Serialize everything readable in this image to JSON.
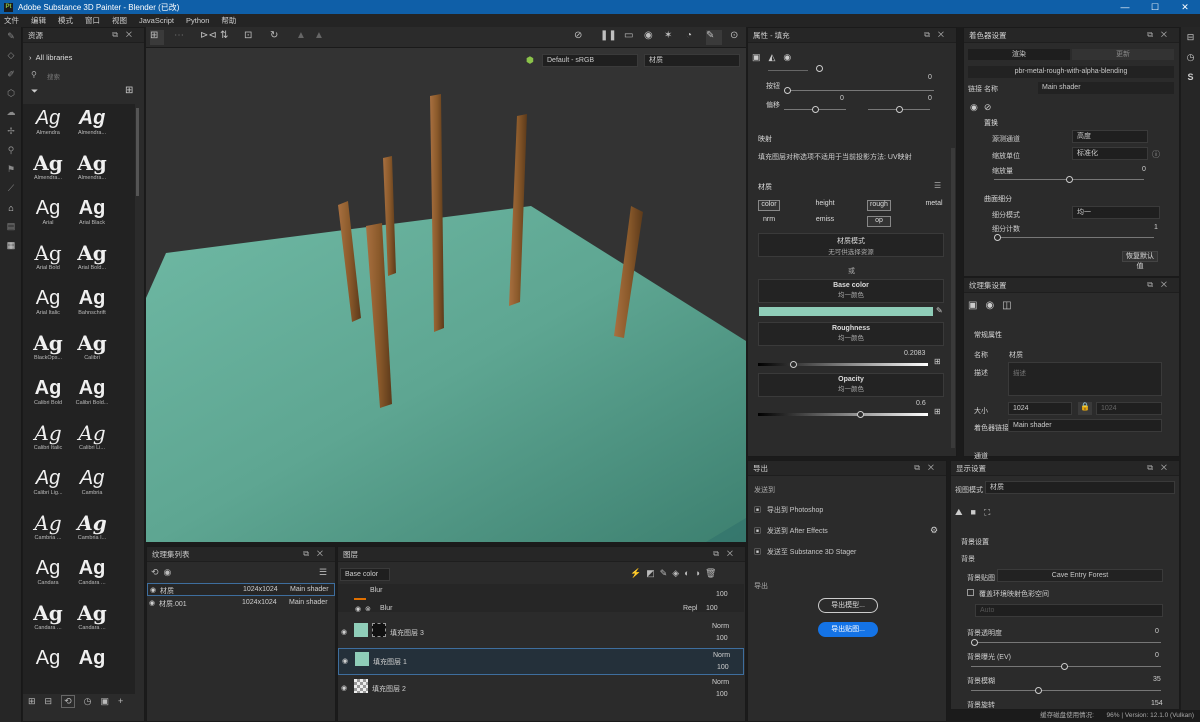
{
  "window": {
    "title": "Adobe Substance 3D Painter - Blender (已改)",
    "controls": [
      "—",
      "☐",
      "✕"
    ]
  },
  "menu": [
    "文件",
    "编辑",
    "模式",
    "窗口",
    "视图",
    "JavaScript",
    "Python",
    "帮助"
  ],
  "assets": {
    "title": "资源",
    "breadcrumb": "All libraries",
    "search_placeholder": "搜索",
    "fonts": [
      [
        "Almendra",
        "Almendra..."
      ],
      [
        "Almendra...",
        "Almendra..."
      ],
      [
        "Arial",
        "Arial Black"
      ],
      [
        "Arial Bold",
        "Arial Bold..."
      ],
      [
        "Arial Italic",
        "Bahnschrift"
      ],
      [
        "BlackOps...",
        "Calibri"
      ],
      [
        "Calibri Bold",
        "Calibri Bold..."
      ],
      [
        "Calibri Italic",
        "Calibri Li..."
      ],
      [
        "Calibri Lig...",
        "Cambria"
      ],
      [
        "Cambria ...",
        "Cambria I..."
      ],
      [
        "Candara",
        "Candara ..."
      ],
      [
        "Candara ...",
        "Candara ..."
      ],
      [
        "",
        ""
      ]
    ]
  },
  "viewport": {
    "colorspace": "Default - sRGB",
    "mode": "材质"
  },
  "textureset_list": {
    "title": "纹理集列表",
    "rows": [
      {
        "name": "材质",
        "size": "1024x1024",
        "shader": "Main shader"
      },
      {
        "name": "材质.001",
        "size": "1024x1024",
        "shader": "Main shader"
      }
    ]
  },
  "layers": {
    "title": "图层",
    "channel": "Base color",
    "rows": [
      {
        "name": "Blur",
        "blend": "Repl",
        "opacity": "100"
      },
      {
        "name": "填充图层 3",
        "blend": "Norm",
        "opacity": "100"
      },
      {
        "name": "填充图层 1",
        "blend": "Norm",
        "opacity": "100"
      },
      {
        "name": "填充图层 2",
        "blend": "Norm",
        "opacity": "100"
      }
    ],
    "top_opacity": "100"
  },
  "properties": {
    "title": "属性 - 填充",
    "top_values": [
      "0",
      "0",
      "0"
    ],
    "row_labels": [
      "按钮",
      "偏移"
    ],
    "projection": {
      "title": "映射",
      "note": "填充图层对称选项不适用于当前投影方法: UV映射"
    },
    "material": {
      "title": "材质",
      "channels": [
        "color",
        "height",
        "rough",
        "metal",
        "nrm",
        "emiss",
        "op"
      ],
      "mode_title": "材质模式",
      "mode_value": "无可供选择资源",
      "or": "或",
      "base_color": {
        "title": "Base color",
        "sub": "均一颜色",
        "color": "#8fcdb8"
      },
      "roughness": {
        "title": "Roughness",
        "sub": "均一颜色",
        "value": "0.2083",
        "fraction": 0.2083
      },
      "opacity": {
        "title": "Opacity",
        "sub": "均一颜色",
        "value": "0.6",
        "fraction": 0.6
      }
    }
  },
  "shader": {
    "title": "着色器设置",
    "tabs": [
      "渲染",
      "更新"
    ],
    "preset": "pbr-metal-rough-with-alpha-blending",
    "link_label": "链接 名称",
    "link_value": "Main shader",
    "section1": "置换",
    "rows": [
      {
        "label": "源测通道",
        "value": "高度"
      },
      {
        "label": "缩放单位",
        "value": "标准化"
      },
      {
        "label": "缩放量",
        "value": "0"
      }
    ],
    "section2": "曲面细分",
    "rows2": [
      {
        "label": "细分模式",
        "value": "均一"
      },
      {
        "label": "细分计数",
        "value": "1"
      }
    ],
    "reset": "恢复默认值"
  },
  "textureset_settings": {
    "title": "纹理集设置",
    "general": "常规属性",
    "name_label": "名称",
    "name_value": "材质",
    "desc_label": "描述",
    "desc_placeholder": "描述",
    "size_label": "大小",
    "size_value": "1024",
    "size_locked": "1024",
    "shader_label": "着色器链接",
    "shader_value": "Main shader",
    "next": "通道"
  },
  "export": {
    "title": "导出",
    "send_to": "发送到",
    "items": [
      "导出到 Photoshop",
      "发送到 After Effects",
      "发送至 Substance 3D Stager"
    ],
    "export_label": "导出",
    "btn1": "导出模型...",
    "btn2": "导出贴图..."
  },
  "display": {
    "title": "显示设置",
    "mode_label": "视图模式",
    "mode_value": "材质",
    "bg_section": "背景设置",
    "bg_label": "背景",
    "bg_map_label": "背景贴图",
    "bg_map_value": "Cave Entry Forest",
    "checkbox": "覆盖环境映射色彩空间",
    "auto": "Auto",
    "rows": [
      {
        "label": "背景透明度",
        "value": "0"
      },
      {
        "label": "背景曝光 (EV)",
        "value": "0"
      },
      {
        "label": "背景模糊",
        "value": "35"
      },
      {
        "label": "背景旋转",
        "value": "154"
      }
    ]
  },
  "status": {
    "cache": "缓存磁盘使用情况:",
    "percent": "96%",
    "version": "Version: 12.1.0 (Vulkan)"
  },
  "colors": {
    "accent": "#0f5fa8",
    "export_btn": "#1473e6",
    "selected_row": "#2f4d6b"
  }
}
